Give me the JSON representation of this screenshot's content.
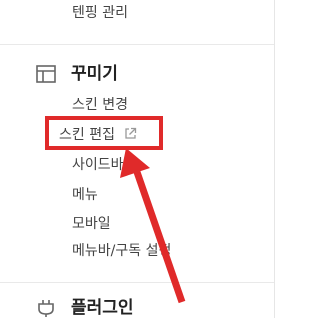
{
  "sidebar": {
    "prev_item": "텐핑 관리",
    "sections": [
      {
        "title": "꾸미기",
        "icon": "layout-icon",
        "items": [
          "스킨 변경",
          "스킨 편집",
          "사이드바",
          "메뉴",
          "모바일",
          "메뉴바/구독 설정"
        ]
      },
      {
        "title": "플러그인",
        "icon": "plug-icon"
      }
    ]
  },
  "annotation": {
    "highlight_color": "#e02a2a",
    "highlighted_item": "스킨 편집"
  }
}
